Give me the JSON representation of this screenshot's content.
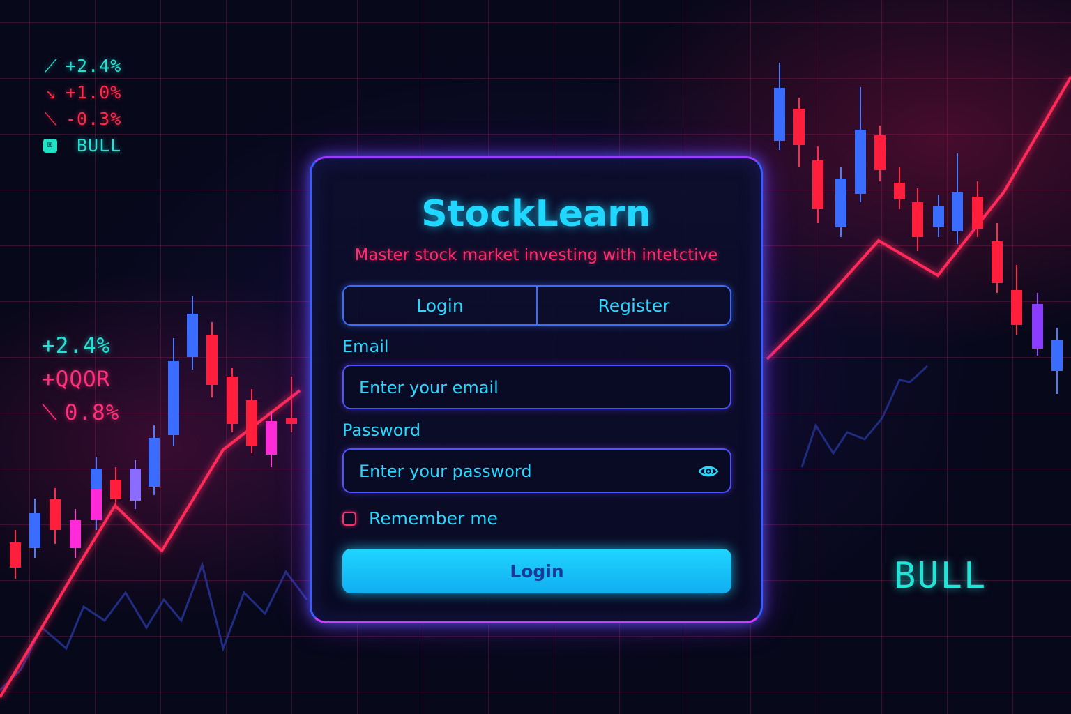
{
  "app": {
    "title": "StockLearn",
    "subtitle": "Master stock market investing with intetctive"
  },
  "tabs": [
    {
      "label": "Login",
      "active": true
    },
    {
      "label": "Register",
      "active": false
    }
  ],
  "form": {
    "email_label": "Email",
    "email_placeholder": "Enter your email",
    "email_value": "",
    "password_label": "Password",
    "password_placeholder": "Enter your password",
    "password_value": "",
    "password_toggle_icon": "eye-icon",
    "remember_label": "Remember me",
    "remember_checked": false,
    "submit_label": "Login"
  },
  "tickers_top": [
    {
      "icon": "up-arrow",
      "text": "+2.4%",
      "color": "#22e3d6"
    },
    {
      "icon": "down-arrow",
      "text": "+1.0%",
      "color": "#ff2a4a"
    },
    {
      "icon": "down-arrow",
      "text": "-0.3%",
      "color": "#ff2a4a"
    },
    {
      "icon": "bull-badge",
      "text": "BULL",
      "color": "#22e3d6"
    }
  ],
  "tickers_mid": [
    {
      "text": "+2.4%",
      "color": "#22e3d6"
    },
    {
      "text": "+QQOR",
      "color": "#ff2f7a"
    },
    {
      "icon": "down-arrow",
      "text": "0.8%",
      "color": "#ff2f7a"
    }
  ],
  "bull_label": "BULL",
  "colors": {
    "accent_cyan": "#1fd7ff",
    "accent_pink": "#ff2d6c",
    "card_border": "#3a5cff",
    "candle_up": "#3a6cff",
    "candle_down": "#ff1f3d"
  }
}
